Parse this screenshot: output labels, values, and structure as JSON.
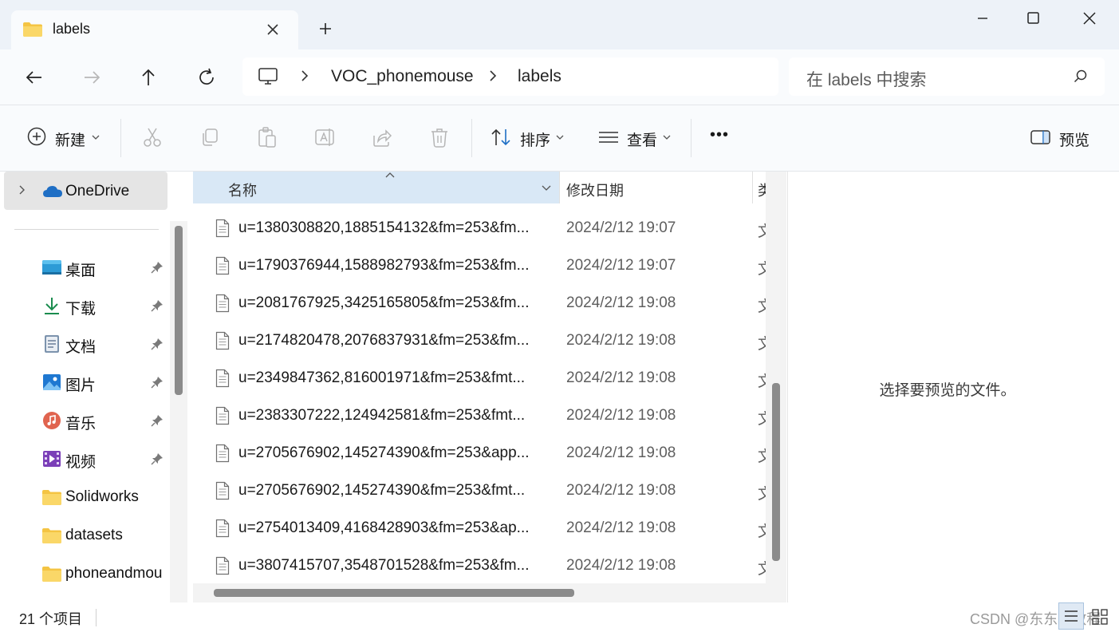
{
  "window": {
    "tab_title": "labels",
    "new_tab_symbol": "+",
    "controls": [
      "minimize-icon",
      "maximize-icon",
      "close-icon"
    ]
  },
  "navigation": {
    "buttons": [
      "back-arrow-icon",
      "forward-arrow-icon",
      "up-arrow-icon",
      "refresh-icon"
    ],
    "breadcrumb": [
      "VOC_phonemouse",
      "labels"
    ],
    "search_placeholder": "在 labels 中搜索"
  },
  "toolbar": {
    "new_label": "新建",
    "sort_label": "排序",
    "view_label": "查看",
    "more_label": "•••",
    "preview_label": "预览",
    "icons": [
      "cut-icon",
      "copy-icon",
      "paste-icon",
      "rename-icon",
      "share-icon",
      "delete-icon"
    ]
  },
  "sidebar": {
    "onedrive": "OneDrive",
    "items": [
      {
        "label": "桌面",
        "icon": "desktop-icon",
        "pinned": true
      },
      {
        "label": "下载",
        "icon": "download-icon",
        "pinned": true
      },
      {
        "label": "文档",
        "icon": "documents-icon",
        "pinned": true
      },
      {
        "label": "图片",
        "icon": "pictures-icon",
        "pinned": true
      },
      {
        "label": "音乐",
        "icon": "music-icon",
        "pinned": true
      },
      {
        "label": "视频",
        "icon": "videos-icon",
        "pinned": true
      },
      {
        "label": "Solidworks",
        "icon": "folder-icon",
        "pinned": false
      },
      {
        "label": "datasets",
        "icon": "folder-icon",
        "pinned": false
      },
      {
        "label": "phoneandmou",
        "icon": "folder-icon",
        "pinned": false
      }
    ]
  },
  "columns": {
    "name": "名称",
    "date": "修改日期",
    "type": "类"
  },
  "files": [
    {
      "name": "u=1380308820,1885154132&fm=253&fm...",
      "date": "2024/2/12 19:07",
      "type": "文"
    },
    {
      "name": "u=1790376944,1588982793&fm=253&fm...",
      "date": "2024/2/12 19:07",
      "type": "文"
    },
    {
      "name": "u=2081767925,3425165805&fm=253&fm...",
      "date": "2024/2/12 19:08",
      "type": "文"
    },
    {
      "name": "u=2174820478,2076837931&fm=253&fm...",
      "date": "2024/2/12 19:08",
      "type": "文"
    },
    {
      "name": "u=2349847362,816001971&fm=253&fmt...",
      "date": "2024/2/12 19:08",
      "type": "文"
    },
    {
      "name": "u=2383307222,124942581&fm=253&fmt...",
      "date": "2024/2/12 19:08",
      "type": "文"
    },
    {
      "name": "u=2705676902,145274390&fm=253&app...",
      "date": "2024/2/12 19:08",
      "type": "文"
    },
    {
      "name": "u=2705676902,145274390&fm=253&fmt...",
      "date": "2024/2/12 19:08",
      "type": "文"
    },
    {
      "name": "u=2754013409,4168428903&fm=253&ap...",
      "date": "2024/2/12 19:08",
      "type": "文"
    },
    {
      "name": "u=3807415707,3548701528&fm=253&fm...",
      "date": "2024/2/12 19:08",
      "type": "文"
    }
  ],
  "preview": {
    "message": "选择要预览的文件。"
  },
  "status": {
    "item_count": "21 个项目",
    "watermark": "CSDN @东东不教程"
  },
  "colors": {
    "titlebar_bg": "#edf2f8",
    "toolbar_bg": "#f9fbfd",
    "header_selected": "#d9e8f6",
    "sidebar_selected": "#e5e5e5",
    "accent_blue": "#1f6fc5"
  }
}
